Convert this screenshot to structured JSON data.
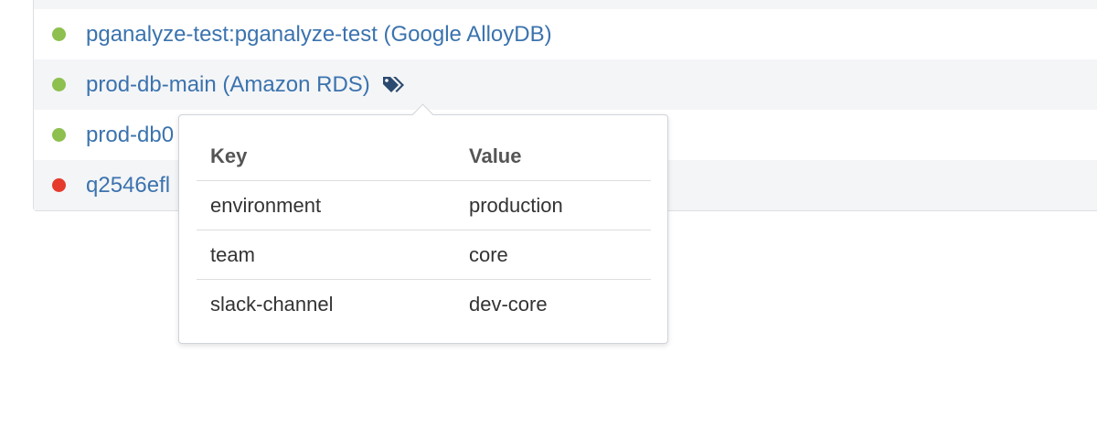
{
  "servers": [
    {
      "name": "pganalyze-test:pganalyze-test (Google AlloyDB)",
      "status": "ok",
      "status_color": "#8dc04f",
      "tagged": false
    },
    {
      "name": "prod-db-main (Amazon RDS)",
      "status": "ok",
      "status_color": "#8dc04f",
      "tagged": true,
      "tag_icon": "tags-icon"
    },
    {
      "name": "prod-db0",
      "status": "ok",
      "status_color": "#8dc04f",
      "tagged": false
    },
    {
      "name": "q2546efl",
      "status": "error",
      "status_color": "#e53a2c",
      "tagged": false
    }
  ],
  "tags_popover": {
    "headers": {
      "key": "Key",
      "value": "Value"
    },
    "rows": [
      {
        "key": "environment",
        "value": "production"
      },
      {
        "key": "team",
        "value": "core"
      },
      {
        "key": "slack-channel",
        "value": "dev-core"
      }
    ]
  },
  "colors": {
    "link": "#3b73ae",
    "ok": "#8dc04f",
    "error": "#e53a2c",
    "tag_icon": "#2b4a6f"
  }
}
